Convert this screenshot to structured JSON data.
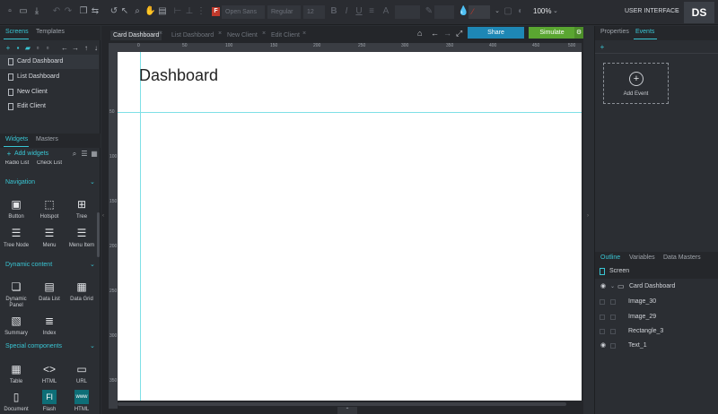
{
  "toolbar": {
    "font_name": "Open Sans",
    "font_style": "Regular",
    "font_size": "12",
    "zoom": "100%",
    "ui_mode": "USER INTERFACE",
    "avatar_initials": "DS"
  },
  "left_panel": {
    "tabs": [
      "Screens",
      "Templates"
    ],
    "screens": [
      "Card Dashboard",
      "List Dashboard",
      "New Client",
      "Edit Client"
    ],
    "widget_tabs": [
      "Widgets",
      "Masters"
    ],
    "add_widgets": "Add widgets",
    "partial_widgets": [
      "Radio List",
      "Check List"
    ],
    "sections": [
      {
        "title": "Navigation",
        "widgets": [
          "Button",
          "Hotspot",
          "Tree",
          "Tree Node",
          "Menu",
          "Menu Item"
        ]
      },
      {
        "title": "Dynamic content",
        "widgets": [
          "Dynamic Panel",
          "Data List",
          "Data Grid",
          "Summary",
          "Index"
        ]
      },
      {
        "title": "Special components",
        "widgets": [
          "Table",
          "HTML",
          "URL",
          "Document",
          "Flash",
          "HTML"
        ]
      }
    ]
  },
  "center": {
    "doc_tabs": [
      "Card Dashboard",
      "List Dashboard",
      "New Client",
      "Edit Client"
    ],
    "share_label": "Share",
    "simulate_label": "Simulate",
    "ruler_h": [
      "0",
      "50",
      "100",
      "150",
      "200",
      "250",
      "300",
      "350",
      "400",
      "450",
      "500"
    ],
    "ruler_v": [
      "50",
      "100",
      "150",
      "200",
      "250",
      "300",
      "350",
      "400"
    ],
    "canvas_title": "Dashboard"
  },
  "right_panel": {
    "tabs": [
      "Properties",
      "Events"
    ],
    "add_event": "Add Event",
    "outline_tabs": [
      "Outline",
      "Variables",
      "Data Masters"
    ],
    "screen_label": "Screen",
    "tree": {
      "root": "Card Dashboard",
      "children": [
        "Image_30",
        "Image_29",
        "Rectangle_3",
        "Text_1"
      ]
    }
  },
  "colors": {
    "accent": "#39c6d4",
    "share": "#1e87b5",
    "simulate": "#5aa631",
    "background": "#2b2e33"
  }
}
